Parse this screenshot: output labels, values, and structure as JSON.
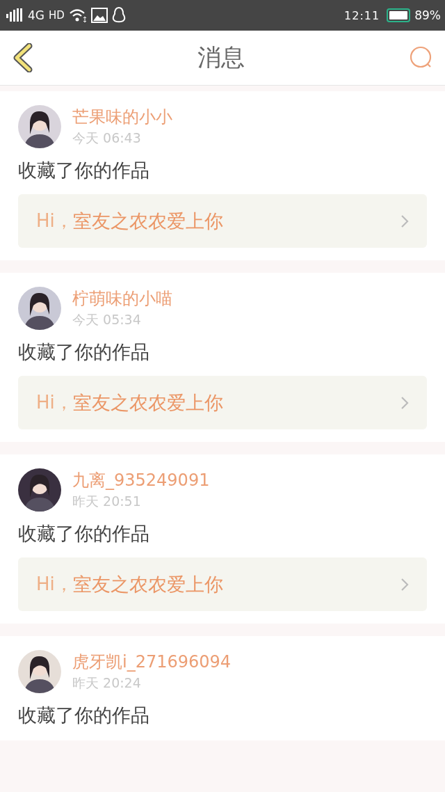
{
  "status_bar": {
    "network": "4G",
    "hd": "HD",
    "time": "12:11",
    "battery": "89%"
  },
  "header": {
    "title": "消息"
  },
  "messages": [
    {
      "name": "芒果味的小小",
      "time": "今天 06:43",
      "action": "收藏了你的作品",
      "link": {
        "greeting": "Hi，",
        "title": "室友之农农爱上你"
      }
    },
    {
      "name": "柠萌味的小喵",
      "time": "今天 05:34",
      "action": "收藏了你的作品",
      "link": {
        "greeting": "Hi，",
        "title": "室友之农农爱上你"
      }
    },
    {
      "name": "九离_935249091",
      "time": "昨天 20:51",
      "action": "收藏了你的作品",
      "link": {
        "greeting": "Hi，",
        "title": "室友之农农爱上你"
      }
    },
    {
      "name": "虎牙凯i_271696094",
      "time": "昨天 20:24",
      "action": "收藏了你的作品"
    }
  ]
}
